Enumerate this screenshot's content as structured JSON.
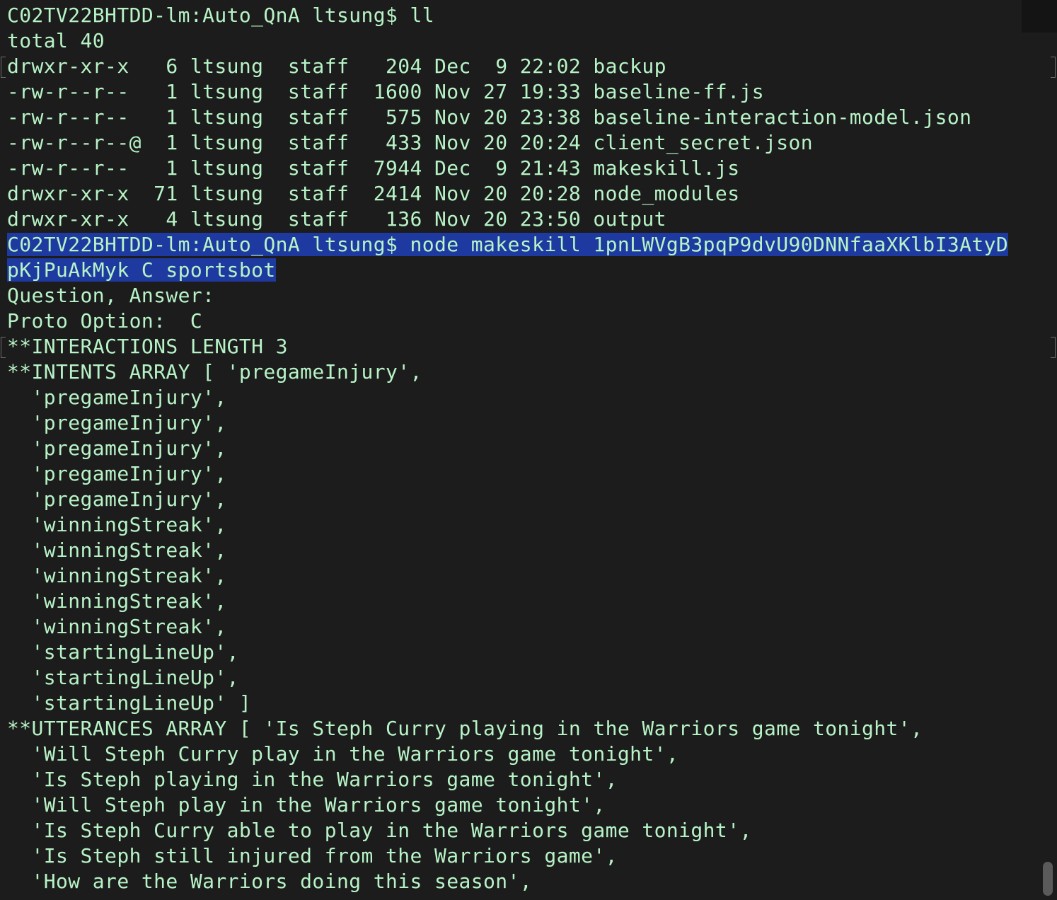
{
  "terminal": {
    "lines": [
      "C02TV22BHTDD-lm:Auto_QnA ltsung$ ll",
      "total 40",
      "drwxr-xr-x   6 ltsung  staff   204 Dec  9 22:02 backup",
      "-rw-r--r--   1 ltsung  staff  1600 Nov 27 19:33 baseline-ff.js",
      "-rw-r--r--   1 ltsung  staff   575 Nov 20 23:38 baseline-interaction-model.json",
      "-rw-r--r--@  1 ltsung  staff   433 Nov 20 20:24 client_secret.json",
      "-rw-r--r--   1 ltsung  staff  7944 Dec  9 21:43 makeskill.js",
      "drwxr-xr-x  71 ltsung  staff  2414 Nov 20 20:28 node_modules",
      "drwxr-xr-x   4 ltsung  staff   136 Nov 20 23:50 output",
      "C02TV22BHTDD-lm:Auto_QnA ltsung$ node makeskill 1pnLWVgB3pqP9dvU90DNNfaaXKlbI3AtyD",
      "pKjPuAkMyk C sportsbot",
      "Question, Answer:",
      "Proto Option:  C",
      "**INTERACTIONS LENGTH 3",
      "**INTENTS ARRAY [ 'pregameInjury',",
      "  'pregameInjury',",
      "  'pregameInjury',",
      "  'pregameInjury',",
      "  'pregameInjury',",
      "  'pregameInjury',",
      "  'winningStreak',",
      "  'winningStreak',",
      "  'winningStreak',",
      "  'winningStreak',",
      "  'winningStreak',",
      "  'startingLineUp',",
      "  'startingLineUp',",
      "  'startingLineUp' ]",
      "**UTTERANCES ARRAY [ 'Is Steph Curry playing in the Warriors game tonight',",
      "  'Will Steph Curry play in the Warriors game tonight',",
      "  'Is Steph playing in the Warriors game tonight',",
      "  'Will Steph play in the Warriors game tonight',",
      "  'Is Steph Curry able to play in the Warriors game tonight',",
      "  'Is Steph still injured from the Warriors game',",
      "  'How are the Warriors doing this season',"
    ]
  }
}
